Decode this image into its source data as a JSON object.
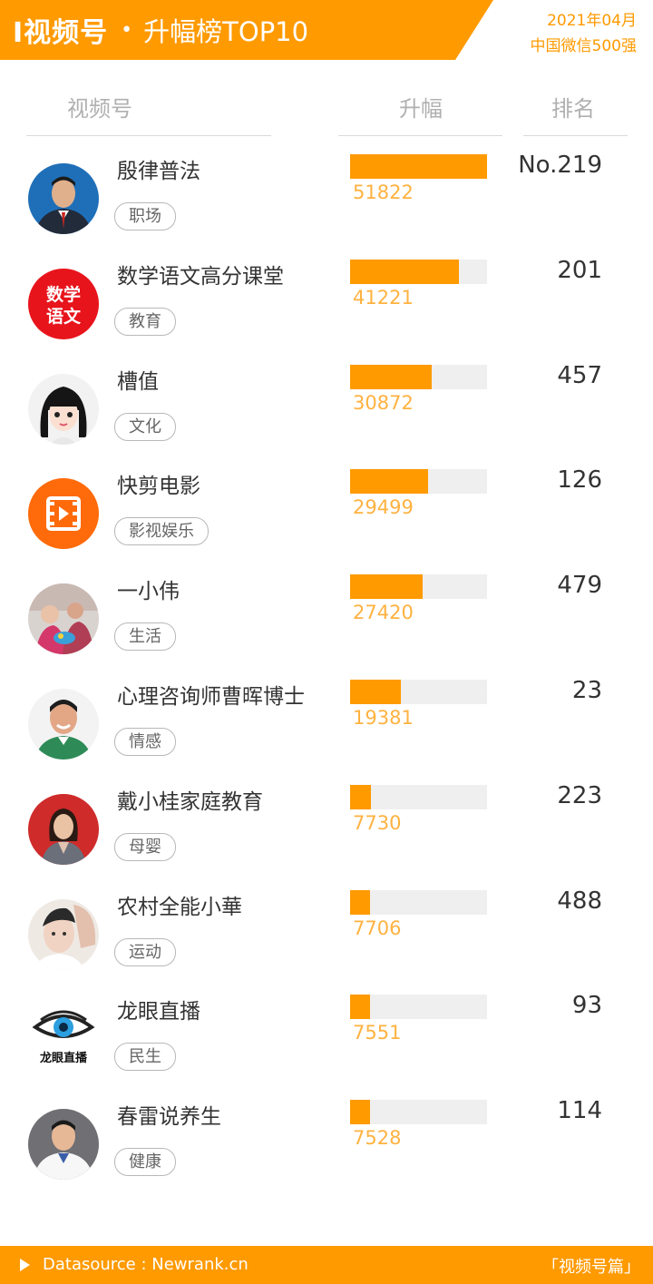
{
  "header": {
    "title": "I视频号",
    "separator": "•",
    "subtitle": "升幅榜TOP10",
    "date": "2021年04月",
    "scope": "中国微信500强"
  },
  "columns": {
    "account": "视频号",
    "rise": "升幅",
    "rank": "排名"
  },
  "colors": {
    "brand": "#ff9a00",
    "bar_track": "#efefef",
    "value_text": "#ffb240"
  },
  "bar_max": 51822,
  "rows": [
    {
      "name": "殷律普法",
      "tag": "职场",
      "rise": 51822,
      "rise_text": "51822",
      "rank": "No.219",
      "avatar": "lawyer-avatar"
    },
    {
      "name": "数学语文高分课堂",
      "tag": "教育",
      "rise": 41221,
      "rise_text": "41221",
      "rank": "201",
      "avatar": "math-chinese-logo-avatar",
      "avatar_text": "数学语文"
    },
    {
      "name": "槽值",
      "tag": "文化",
      "rise": 30872,
      "rise_text": "30872",
      "rank": "457",
      "avatar": "cartoon-girl-avatar"
    },
    {
      "name": "快剪电影",
      "tag": "影视娱乐",
      "rise": 29499,
      "rise_text": "29499",
      "rank": "126",
      "avatar": "film-play-avatar"
    },
    {
      "name": "一小伟",
      "tag": "生活",
      "rise": 27420,
      "rise_text": "27420",
      "rank": "479",
      "avatar": "photo-avatar"
    },
    {
      "name": "心理咨询师曹晖博士",
      "tag": "情感",
      "rise": 19381,
      "rise_text": "19381",
      "rank": "23",
      "avatar": "man-avatar"
    },
    {
      "name": "戴小桂家庭教育",
      "tag": "母婴",
      "rise": 7730,
      "rise_text": "7730",
      "rank": "223",
      "avatar": "woman-avatar"
    },
    {
      "name": "农村全能小華",
      "tag": "运动",
      "rise": 7706,
      "rise_text": "7706",
      "rank": "488",
      "avatar": "young-man-avatar"
    },
    {
      "name": "龙眼直播",
      "tag": "民生",
      "rise": 7551,
      "rise_text": "7551",
      "rank": "93",
      "avatar": "eye-logo-avatar",
      "avatar_text": "龙眼直播"
    },
    {
      "name": "春雷说养生",
      "tag": "健康",
      "rise": 7528,
      "rise_text": "7528",
      "rank": "114",
      "avatar": "doctor-avatar"
    }
  ],
  "footer": {
    "source": "Datasource : Newrank.cn",
    "brand": "「视频号篇」"
  }
}
